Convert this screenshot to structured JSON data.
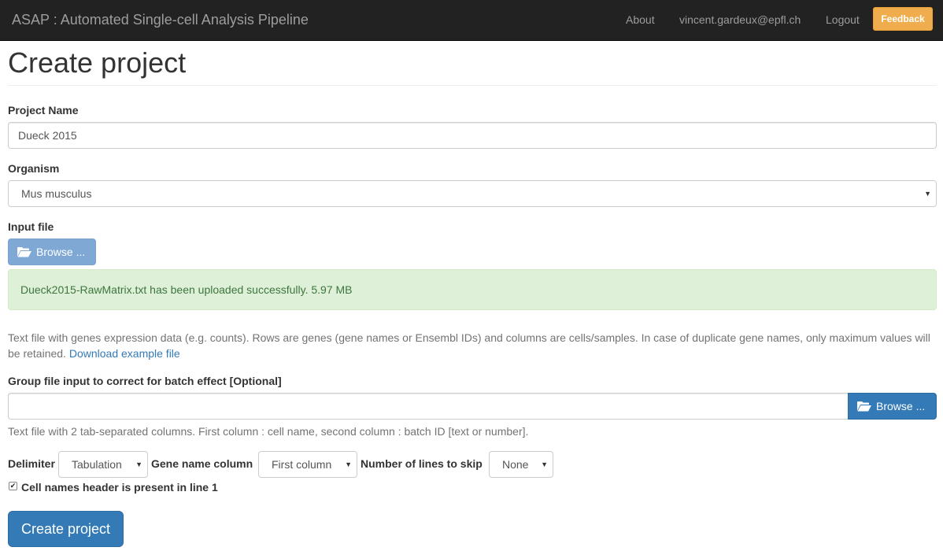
{
  "navbar": {
    "brand": "ASAP : Automated Single-cell Analysis Pipeline",
    "links": [
      "About",
      "vincent.gardeux@epfl.ch",
      "Logout"
    ],
    "feedback_label": "Feedback"
  },
  "page": {
    "title": "Create project"
  },
  "project_name": {
    "label": "Project Name",
    "value": "Dueck 2015"
  },
  "organism": {
    "label": "Organism",
    "value": "Mus musculus"
  },
  "input_file": {
    "label": "Input file",
    "browse_label": "Browse ...",
    "success_message": "Dueck2015-RawMatrix.txt has been uploaded successfully. 5.97 MB",
    "help_text": "Text file with genes expression data (e.g. counts). Rows are genes (gene names or Ensembl IDs) and columns are cells/samples. In case of duplicate gene names, only maximum values will be retained.",
    "example_link": "Download example file"
  },
  "group_file": {
    "label": "Group file input to correct for batch effect [Optional]",
    "value": "",
    "browse_label": "Browse ...",
    "help_text": "Text file with 2 tab-separated columns. First column : cell name, second column : batch ID [text or number]."
  },
  "options": {
    "delimiter_label": "Delimiter",
    "delimiter_value": "Tabulation",
    "gene_column_label": "Gene name column",
    "gene_column_value": "First column",
    "skip_lines_label": "Number of lines to skip",
    "skip_lines_value": "None",
    "header_checkbox_label": "Cell names header is present in line 1",
    "header_checked": true
  },
  "submit_label": "Create project",
  "colors": {
    "navbar_bg": "#222222",
    "feedback": "#f0ad4e",
    "primary": "#337ab7",
    "success_bg": "#dff0d8",
    "success_text": "#3c763d"
  },
  "icons": [
    "folder-open-icon",
    "chevron-down-icon",
    "checkmark-icon"
  ]
}
